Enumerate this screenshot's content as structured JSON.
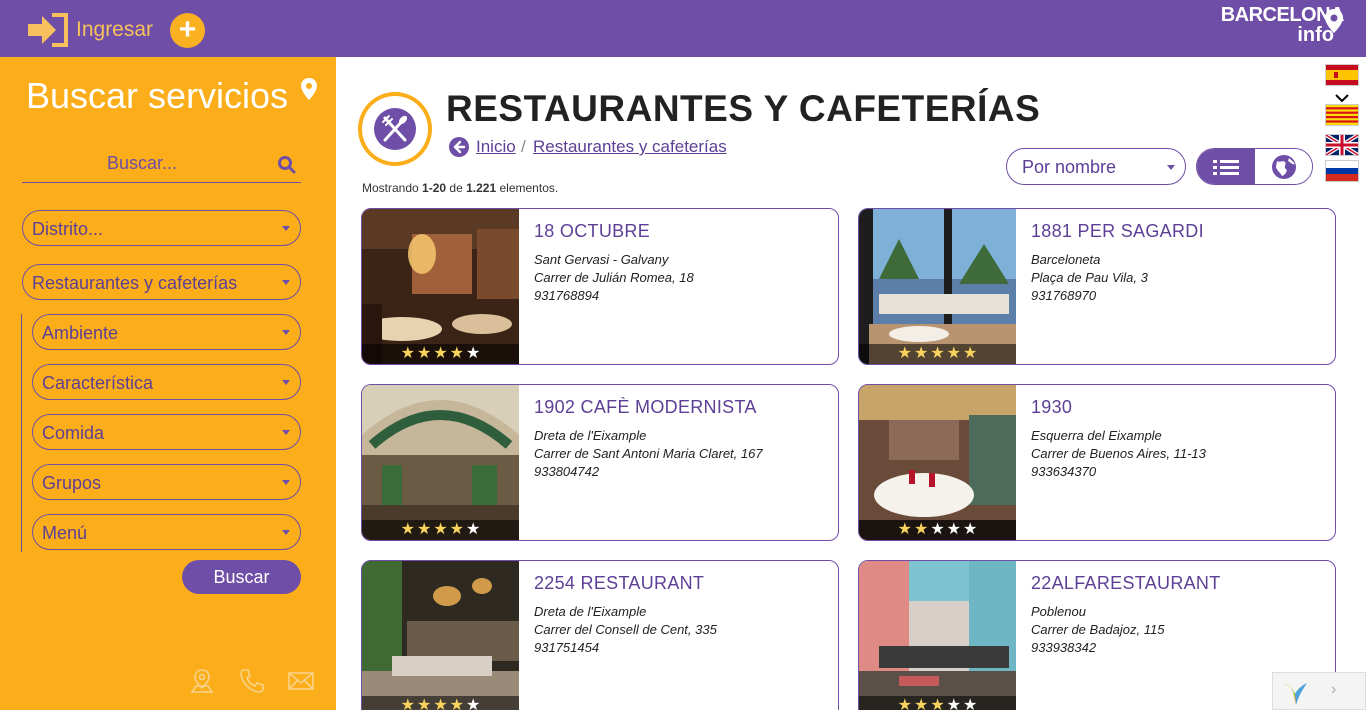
{
  "topbar": {
    "login_label": "Ingresar",
    "add_label": "+",
    "brand_name": "BARCELONA",
    "brand_sub": "info"
  },
  "sidebar": {
    "title": "Buscar servicios",
    "search_placeholder": "Buscar...",
    "filters": [
      {
        "label": "Distrito..."
      },
      {
        "label": "Restaurantes y cafeterías"
      }
    ],
    "sub_filters": [
      {
        "label": "Ambiente"
      },
      {
        "label": "Característica"
      },
      {
        "label": "Comida"
      },
      {
        "label": "Grupos"
      },
      {
        "label": "Menú"
      }
    ],
    "search_button": "Buscar"
  },
  "main": {
    "title": "RESTAURANTES Y CAFETERÍAS",
    "breadcrumb": [
      {
        "label": "Inicio"
      },
      {
        "label": "Restaurantes y cafeterías"
      }
    ],
    "breadcrumb_separator": "/",
    "sort_label": "Por nombre",
    "count": {
      "prefix": "Mostrando",
      "range": "1-20",
      "middle": "de",
      "total": "1.221",
      "suffix": "elementos."
    }
  },
  "languages": [
    "es",
    "ca",
    "en",
    "ru"
  ],
  "restaurants": [
    {
      "name": "18 OCTUBRE",
      "district": "Sant Gervasi - Galvany",
      "address": "Carrer de Julián Romea, 18",
      "phone": "931768894",
      "rating": 4
    },
    {
      "name": "1881 PER SAGARDI",
      "district": "Barceloneta",
      "address": "Plaça de Pau Vila, 3",
      "phone": "931768970",
      "rating": 5
    },
    {
      "name": "1902 CAFÈ MODERNISTA",
      "district": "Dreta de l'Eixample",
      "address": "Carrer de Sant Antoni Maria Claret, 167",
      "phone": "933804742",
      "rating": 4
    },
    {
      "name": "1930",
      "district": "Esquerra del Eixample",
      "address": "Carrer de Buenos Aires, 11-13",
      "phone": "933634370",
      "rating": 2
    },
    {
      "name": "2254 RESTAURANT",
      "district": "Dreta de l'Eixample",
      "address": "Carrer del Consell de Cent, 335",
      "phone": "931751454",
      "rating": 4
    },
    {
      "name": "22ALFARESTAURANT",
      "district": "Poblenou",
      "address": "Carrer de Badajoz, 115",
      "phone": "933938342",
      "rating": 3
    }
  ],
  "colors": {
    "brand": "#6e4ea6",
    "accent": "#fbae1a"
  },
  "footer_badge_arrow": "›"
}
